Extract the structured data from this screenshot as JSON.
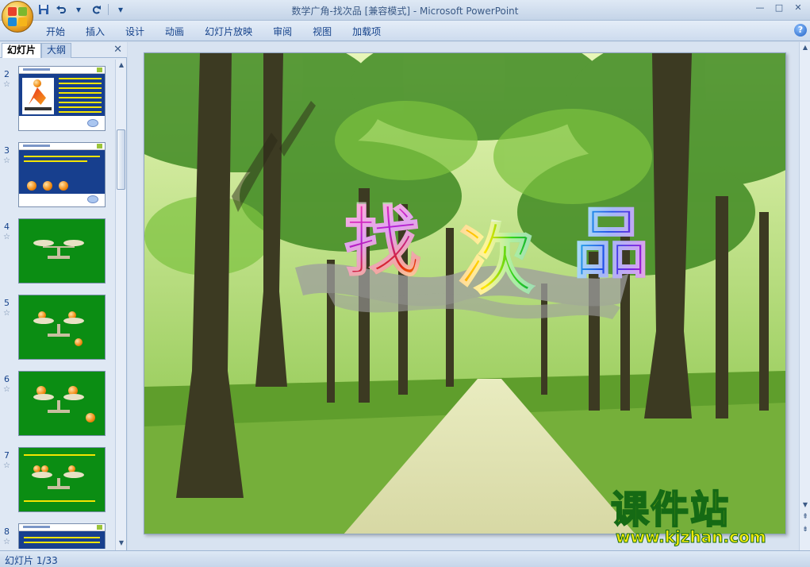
{
  "window": {
    "title": "数学广角-找次品 [兼容模式] - Microsoft PowerPoint"
  },
  "quick_access": {
    "icons": [
      "save-icon",
      "undo-icon",
      "redo-icon",
      "customize-icon"
    ],
    "undo_arrow": "▾",
    "customize": "▾"
  },
  "window_controls": {
    "minimize": "—",
    "maximize": "□",
    "close": "✕"
  },
  "ribbon": {
    "tabs": [
      "开始",
      "插入",
      "设计",
      "动画",
      "幻灯片放映",
      "审阅",
      "视图",
      "加载项"
    ],
    "help": "?"
  },
  "left_pane": {
    "tabs": [
      "幻灯片",
      "大纲"
    ],
    "close": "✕",
    "slides": [
      {
        "number": "2",
        "style": "white"
      },
      {
        "number": "3",
        "style": "blue"
      },
      {
        "number": "4",
        "style": "green"
      },
      {
        "number": "5",
        "style": "green"
      },
      {
        "number": "6",
        "style": "green"
      },
      {
        "number": "7",
        "style": "green"
      },
      {
        "number": "8",
        "style": "white"
      }
    ],
    "star": "☆"
  },
  "slide": {
    "title_chars": [
      "找",
      "次",
      "品"
    ]
  },
  "watermark": {
    "line1": "课件站",
    "line2": "www.kjzhan.com"
  },
  "scroll": {
    "up": "▲",
    "down": "▼",
    "prev": "⇞",
    "next": "⇟"
  },
  "status": {
    "text": "幻灯片 1/33"
  }
}
